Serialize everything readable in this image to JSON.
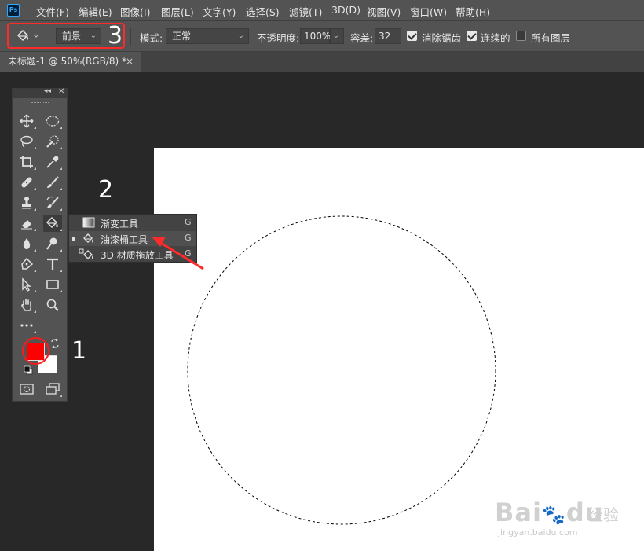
{
  "app": {
    "logo_text": "Ps"
  },
  "menu": [
    {
      "label": "文件(F)"
    },
    {
      "label": "编辑(E)"
    },
    {
      "label": "图像(I)"
    },
    {
      "label": "图层(L)"
    },
    {
      "label": "文字(Y)"
    },
    {
      "label": "选择(S)"
    },
    {
      "label": "滤镜(T)"
    },
    {
      "label": "3D(D)"
    },
    {
      "label": "视图(V)"
    },
    {
      "label": "窗口(W)"
    },
    {
      "label": "帮助(H)"
    }
  ],
  "options": {
    "fill_source": "前景",
    "mode_label": "模式:",
    "mode_value": "正常",
    "opacity_label": "不透明度:",
    "opacity_value": "100%",
    "tolerance_label": "容差:",
    "tolerance_value": "32",
    "anti_alias_label": "消除锯齿",
    "anti_alias_checked": true,
    "contiguous_label": "连续的",
    "contiguous_checked": true,
    "all_layers_label": "所有图层",
    "all_layers_checked": false
  },
  "document_tab": {
    "title": "未标题-1 @ 50%(RGB/8) *",
    "close_glyph": "×"
  },
  "toolbar": {
    "collapse_glyph": "◂◂",
    "close_glyph": "✕",
    "foreground_color": "#ff0000",
    "background_color": "#ffffff"
  },
  "flyout": [
    {
      "label": "渐变工具",
      "shortcut": "G",
      "icon": "gradient-icon",
      "selected": false
    },
    {
      "label": "油漆桶工具",
      "shortcut": "G",
      "icon": "paint-bucket-icon",
      "selected": true
    },
    {
      "label": "3D 材质拖放工具",
      "shortcut": "G",
      "icon": "3d-material-drop-icon",
      "selected": false
    }
  ],
  "annotations": {
    "one": "1",
    "two": "2",
    "three": "3"
  },
  "colors": {
    "annotation_red": "#ff2a2a",
    "panel": "#535353",
    "workspace": "#282828"
  },
  "watermark": {
    "brand": "Bai",
    "brand2": "du",
    "suffix": "经验",
    "url": "jingyan.baidu.com"
  }
}
